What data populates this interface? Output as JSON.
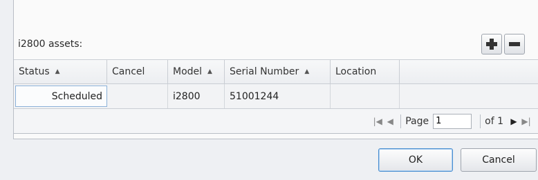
{
  "assets_label": "i2800 assets:",
  "toolbar": {
    "add_icon": "plus-icon",
    "remove_icon": "minus-icon"
  },
  "columns": {
    "status": "Status",
    "cancel": "Cancel",
    "model": "Model",
    "serial": "Serial Number",
    "location": "Location"
  },
  "rows": [
    {
      "status": "Scheduled",
      "cancel": "",
      "model": "i2800",
      "serial": "51001244",
      "location": ""
    }
  ],
  "pager": {
    "page_label": "Page",
    "page_value": "1",
    "of_label": "of 1"
  },
  "buttons": {
    "ok": "OK",
    "cancel": "Cancel"
  },
  "colors": {
    "accent": "#4a8ed0",
    "selection_border": "#8ab0d8"
  }
}
